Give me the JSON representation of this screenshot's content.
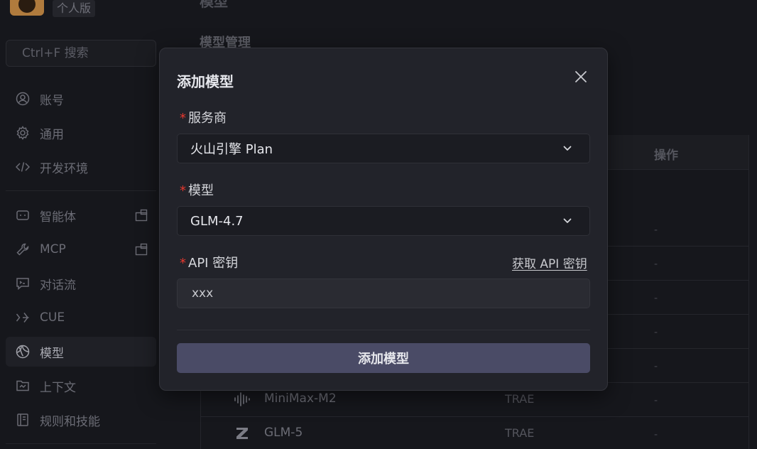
{
  "sidebar": {
    "plan_badge": "个人版",
    "search_placeholder": "Ctrl+F 搜索",
    "items": [
      {
        "label": "账号"
      },
      {
        "label": "通用"
      },
      {
        "label": "开发环境"
      },
      {
        "label": "智能体"
      },
      {
        "label": "MCP"
      },
      {
        "label": "对话流"
      },
      {
        "label": "CUE"
      },
      {
        "label": "模型"
      },
      {
        "label": "上下文"
      },
      {
        "label": "规则和技能"
      }
    ]
  },
  "main": {
    "section_title": "模型管理",
    "table": {
      "ops_header": "操作",
      "dash": "-",
      "rows": [
        {
          "name": "MiniMax-M2",
          "provider": "TRAE"
        },
        {
          "name": "GLM-5",
          "provider": "TRAE"
        }
      ]
    }
  },
  "modal": {
    "title": "添加模型",
    "required_mark": "*",
    "provider_label": "服务商",
    "provider_value": "火山引擎 Plan",
    "model_label": "模型",
    "model_value": "GLM-4.7",
    "api_key_label": "API 密钥",
    "get_key_link": "获取 API 密钥",
    "api_key_value": "xxx",
    "submit_label": "添加模型"
  },
  "colors": {
    "accent_button": "#4a4b66",
    "required": "#e5382e",
    "modal_bg": "#22232a",
    "page_bg": "#16171c"
  }
}
